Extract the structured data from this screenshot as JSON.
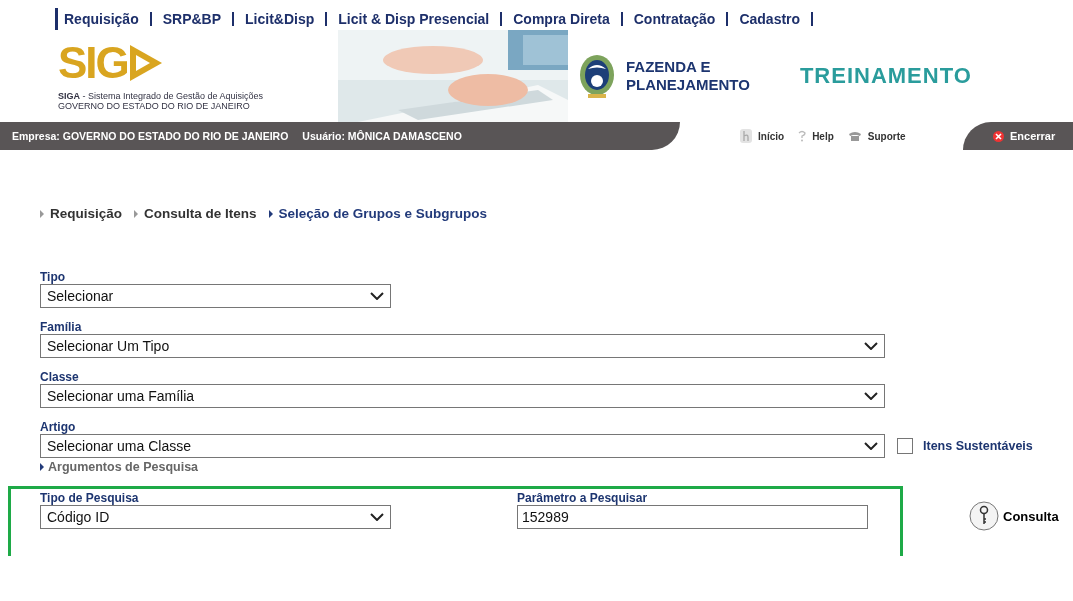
{
  "top_menu": [
    "Requisição",
    "SRP&BP",
    "Licit&Disp",
    "Licit & Disp Presencial",
    "Compra Direta",
    "Contratação",
    "Cadastro"
  ],
  "header": {
    "logo": "SIG",
    "system_name": "**SIGA** - Sistema Integrado de Gestão de Aquisições",
    "government": "GOVERNO DO ESTADO DO RIO DE JANEIRO",
    "agency": [
      "FAZENDA E",
      "PLANEJAMENTO"
    ],
    "environment": "TREINAMENTO",
    "photo": {
      "kind": "picture"
    }
  },
  "user_bar": {
    "company": "Empresa: GOVERNO DO ESTADO DO RIO DE JANEIRO",
    "user": "Usuário: MÔNICA DAMASCENO",
    "links": [
      {
        "kind": "home",
        "label": "Início"
      },
      {
        "kind": "help",
        "label": "Help"
      },
      {
        "kind": "support",
        "label": "Suporte"
      }
    ],
    "logout": "Encerrar"
  },
  "breadcrumb": [
    {
      "label": "Requisição",
      "selected": false
    },
    {
      "label": "Consulta de Itens",
      "selected": false
    },
    {
      "label": "Seleção de Grupos e Subgrupos",
      "selected": true
    }
  ],
  "fields": [
    {
      "label": "Tipo",
      "value": "Selecionar",
      "kind": "short"
    },
    {
      "label": "Família",
      "value": "Selecionar Um Tipo",
      "kind": "long"
    },
    {
      "label": "Classe",
      "value": "Selecionar uma Família",
      "kind": "long"
    },
    {
      "label": "Artigo",
      "value": "Selecionar uma Classe",
      "kind": "long"
    }
  ],
  "sustainable": {
    "label": "Itens Sustentáveis",
    "checked": false
  },
  "search_args_link": "Argumentos de Pesquisa",
  "search": {
    "type_label": "Tipo de Pesquisa",
    "type_value": "Código ID",
    "param_label": "Parâmetro a Pesquisar",
    "param_value": "152989",
    "button": "Consulta"
  }
}
